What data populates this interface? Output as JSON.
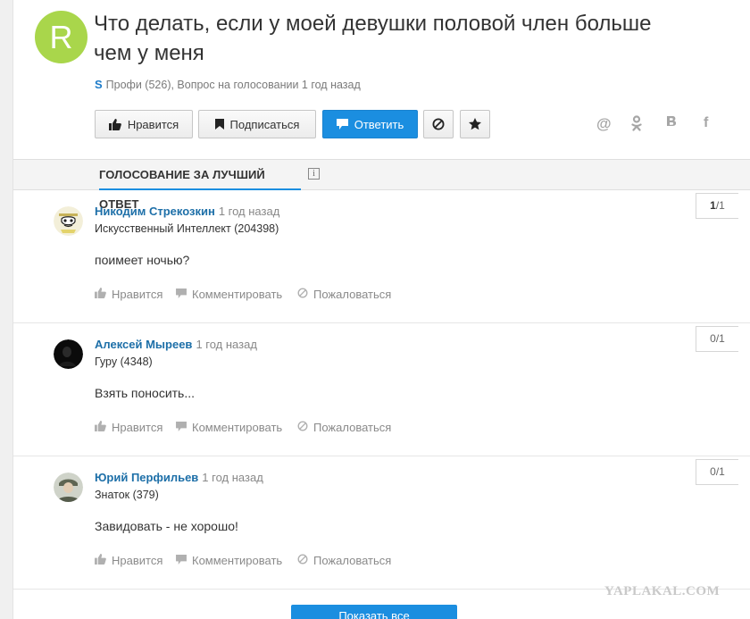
{
  "question": {
    "avatar_letter": "R",
    "avatar_color": "#a9d64b",
    "title": "Что делать, если у моей девушки половой член больше чем у меня",
    "meta": "Профи (526), Вопрос на голосовании 1 год назад"
  },
  "toolbar": {
    "like_label": "Нравится",
    "subscribe_label": "Подписаться",
    "answer_label": "Ответить"
  },
  "share": {
    "mail": "@",
    "ok": "ок",
    "vk": "в",
    "fb": "f"
  },
  "tabs": {
    "voting_label": "ГОЛОСОВАНИЕ ЗА ЛУЧШИЙ ОТВЕТ",
    "info": "i"
  },
  "answers": [
    {
      "name": "Никодим Стрекозкин",
      "time": "1 год назад",
      "rank": "Искусственный Интеллект (204398)",
      "text": "поимеет ночью?",
      "vote_count": "1",
      "vote_total": "/1",
      "like": "Нравится",
      "comment": "Комментировать",
      "report": "Пожаловаться"
    },
    {
      "name": "Алексей Мыреев",
      "time": "1 год назад",
      "rank": "Гуру (4348)",
      "text": "Взять поносить...",
      "vote_count": "0",
      "vote_total": "/1",
      "like": "Нравится",
      "comment": "Комментировать",
      "report": "Пожаловаться"
    },
    {
      "name": "Юрий Перфильев",
      "time": "1 год назад",
      "rank": "Знаток (379)",
      "text": "Завидовать - не хорошо!",
      "vote_count": "0",
      "vote_total": "/1",
      "like": "Нравится",
      "comment": "Комментировать",
      "report": "Пожаловаться"
    }
  ],
  "show_all_label": "Показать все",
  "watermark": "YAPLAKAL.COM",
  "colors": {
    "accent": "#1b8ee0",
    "name_link": "#1d6fa8"
  }
}
